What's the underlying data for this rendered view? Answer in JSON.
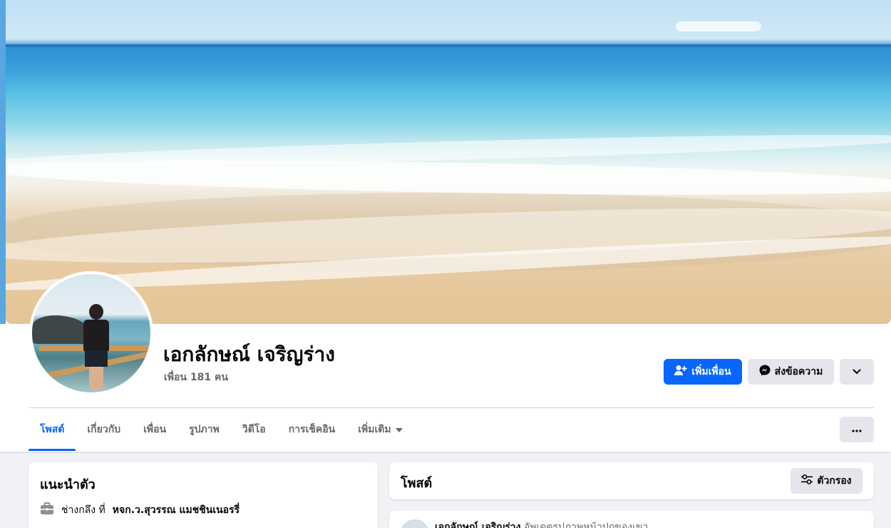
{
  "profile": {
    "name": "เอกลักษณ์ เจริญร่าง",
    "friends_count": "เพื่อน 181 คน"
  },
  "actions": {
    "add_friend": "เพิ่มเพื่อน",
    "message": "ส่งข้อความ"
  },
  "tabs": [
    {
      "label": "โพสต์"
    },
    {
      "label": "เกี่ยวกับ"
    },
    {
      "label": "เพื่อน"
    },
    {
      "label": "รูปภาพ"
    },
    {
      "label": "วิดีโอ"
    },
    {
      "label": "การเช็คอิน"
    },
    {
      "label": "เพิ่มเติม"
    }
  ],
  "intro": {
    "title": "แนะนำตัว",
    "work_prefix": "ช่างกลึง ที่",
    "work_place": "หจก.ว.สุวรรณ แมชชินเนอรรี่"
  },
  "posts": {
    "title": "โพสต์",
    "filter_label": "ตัวกรอง"
  },
  "post": {
    "author": "เอกลักษณ์ เจริญร่าง",
    "action": "อัพเดตรูปภาพหน้าปกของเขา"
  },
  "colors": {
    "accent": "#0866ff",
    "button_grey": "#e4e6eb",
    "page_bg": "#f0f2f5",
    "secondary_text": "#65676b"
  }
}
